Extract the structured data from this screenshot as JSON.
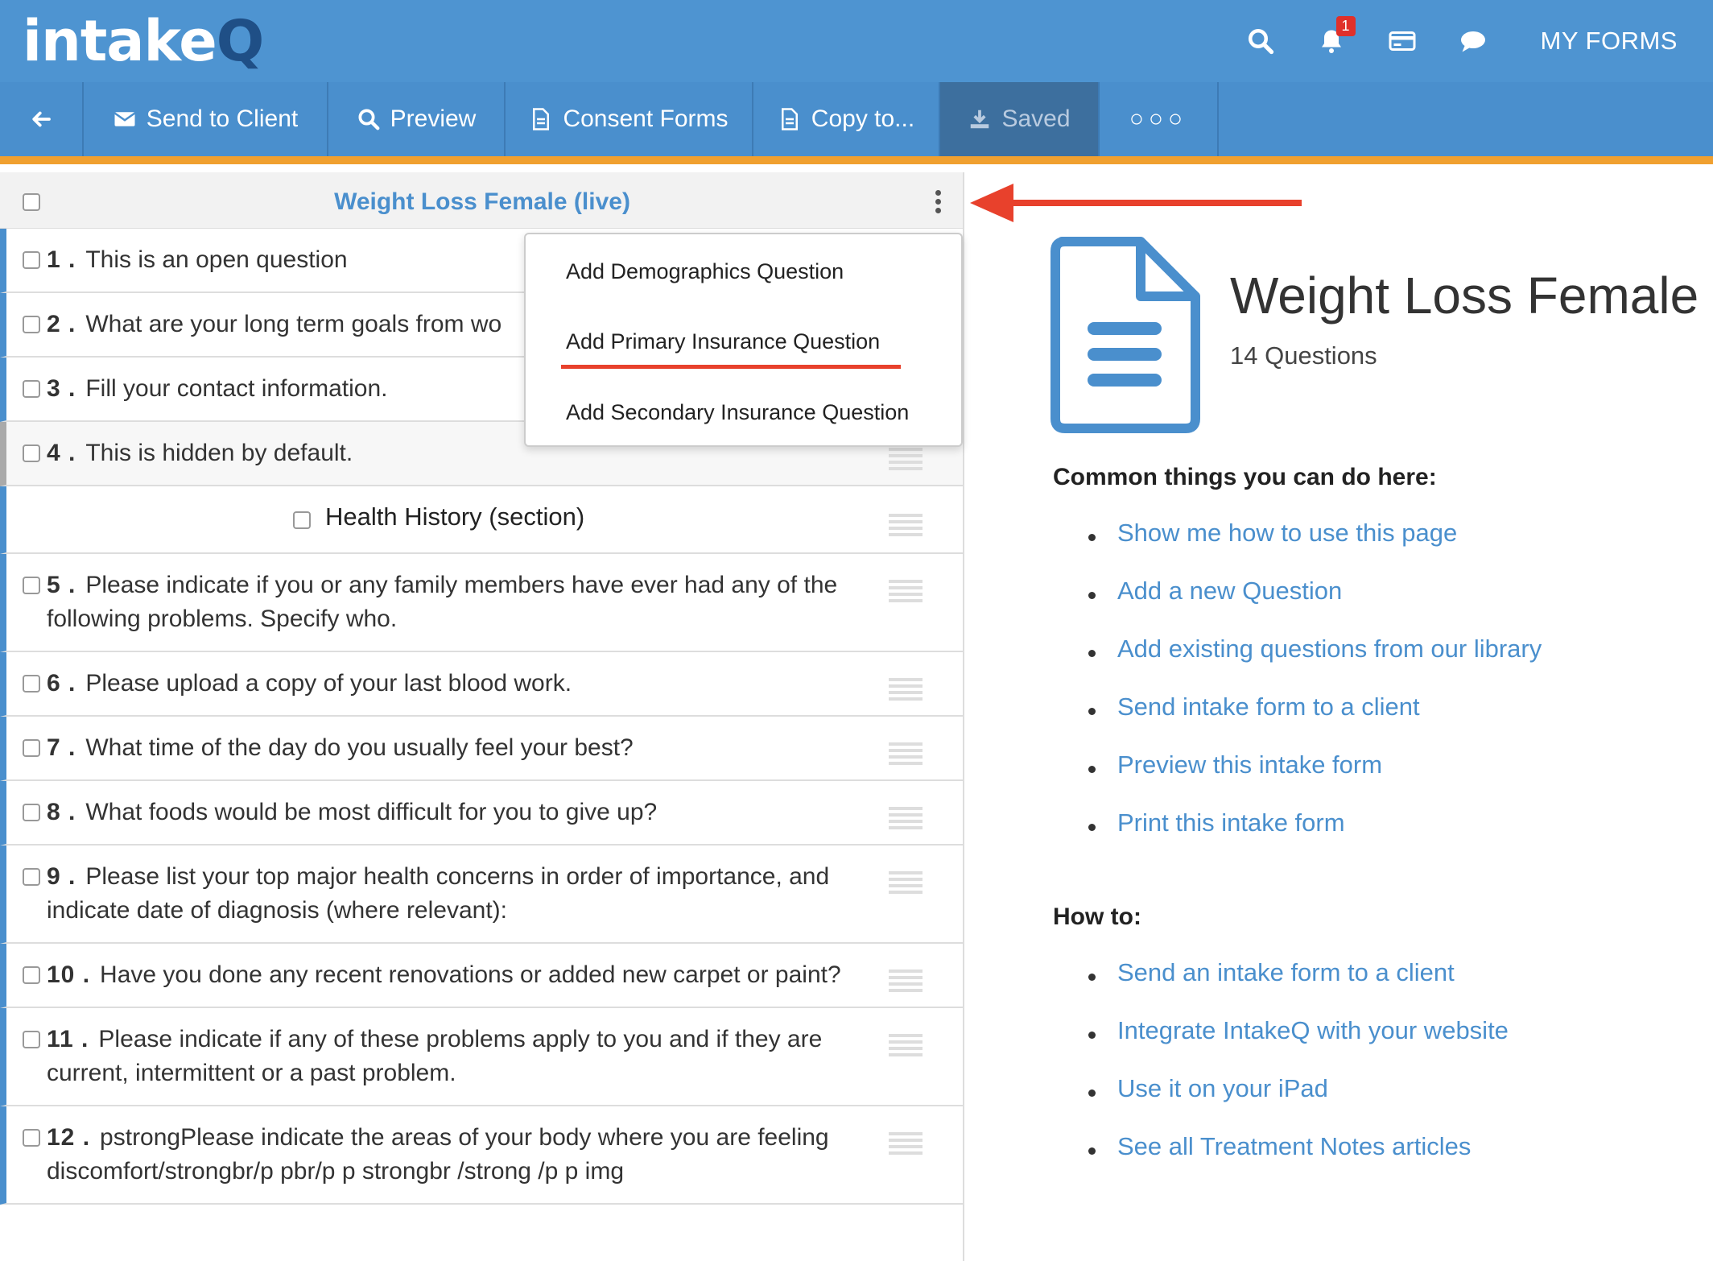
{
  "brand": {
    "logo_main": "intake",
    "logo_q": "Q"
  },
  "topnav": {
    "notification_count": "1",
    "my_forms_label": "MY FORMS"
  },
  "toolbar": {
    "send_label": "Send to Client",
    "preview_label": "Preview",
    "consent_label": "Consent Forms",
    "copy_label": "Copy to...",
    "saved_label": "Saved",
    "more_label": "○○○"
  },
  "form": {
    "title": "Weight Loss Female (live)"
  },
  "questions": [
    {
      "num": "1 .",
      "text": "This is an open question"
    },
    {
      "num": "2 .",
      "text": "What are your long term goals from wo"
    },
    {
      "num": "3 .",
      "text": "Fill your contact information."
    },
    {
      "num": "4 .",
      "text": "This is hidden by default."
    },
    {
      "num": "5 .",
      "text": "Please indicate if you or any family members have ever had any of the following problems. Specify who."
    },
    {
      "num": "6 .",
      "text": "Please upload a copy of your last blood work."
    },
    {
      "num": "7 .",
      "text": "What time of the day do you usually feel your best?"
    },
    {
      "num": "8 .",
      "text": "What foods would be most difficult for you to give up?"
    },
    {
      "num": "9 .",
      "text": "Please list your top major health concerns in order of importance, and indicate date of diagnosis (where relevant):"
    },
    {
      "num": "10 .",
      "text": "Have you done any recent renovations or added new carpet or paint?"
    },
    {
      "num": "11 .",
      "text": "Please indicate if any of these problems apply to you and if they are current, intermittent or a past problem."
    },
    {
      "num": "12 .",
      "text": "pstrongPlease indicate the areas of your body where you are feeling discomfort/strongbr/p pbr/p p strongbr /strong /p p img"
    }
  ],
  "section": {
    "label": "Health History (section)"
  },
  "dropdown": {
    "item1": "Add Demographics Question",
    "item2": "Add Primary Insurance Question",
    "item3": "Add Secondary Insurance Question"
  },
  "right": {
    "title": "Weight Loss Female (l",
    "count": "14 Questions",
    "common_heading": "Common things you can do here:",
    "common_links": [
      "Show me how to use this page",
      "Add a new Question",
      "Add existing questions from our library",
      "Send intake form to a client",
      "Preview this intake form",
      "Print this intake form"
    ],
    "howto_heading": "How to:",
    "howto_links": [
      "Send an intake form to a client",
      "Integrate IntakeQ with your website",
      "Use it on your iPad",
      "See all Treatment Notes articles"
    ]
  },
  "colors": {
    "brand_blue": "#4e94d1",
    "accent_orange": "#f0a030",
    "annotation_red": "#e8412c",
    "link_blue": "#4a8fcd"
  }
}
